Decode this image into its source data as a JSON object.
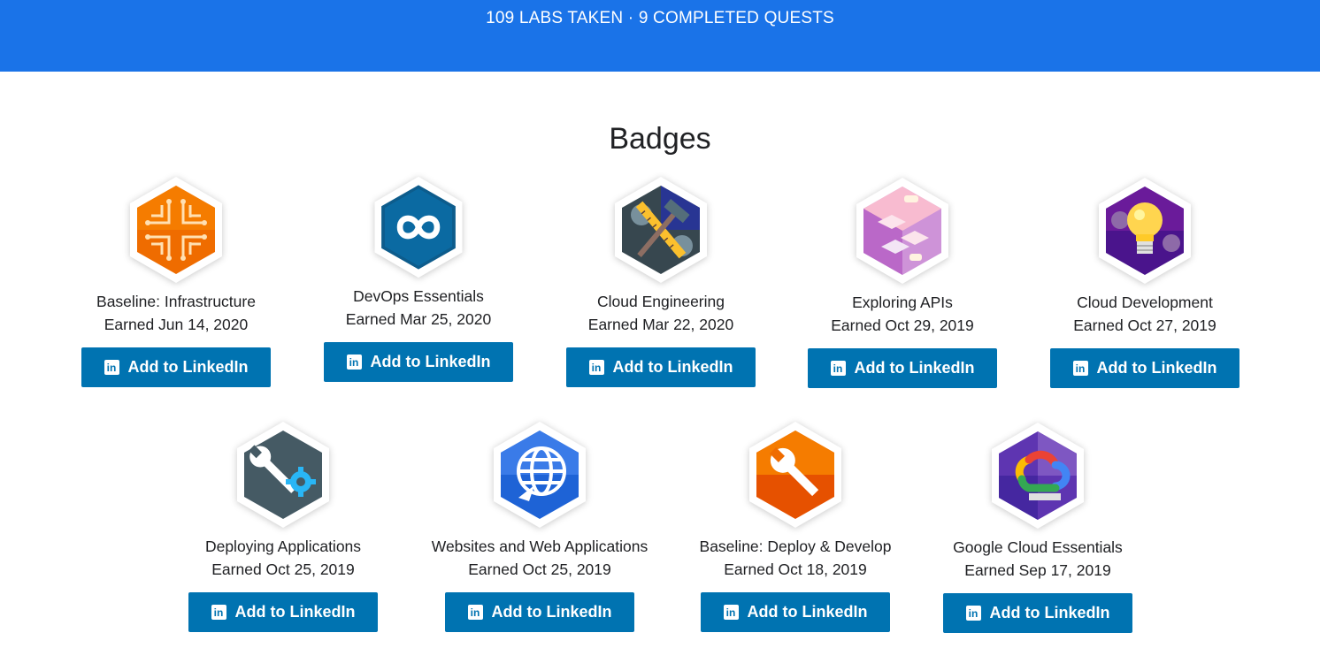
{
  "banner": {
    "stats": "109 LABS TAKEN · 9 COMPLETED QUESTS",
    "color": "#1a73e8"
  },
  "section": {
    "title": "Badges"
  },
  "linkedin": {
    "label": "Add to LinkedIn",
    "icon": "linkedin-icon",
    "color": "#0073b1"
  },
  "badges": [
    {
      "name": "Baseline: Infrastructure",
      "earned": "Earned Jun 14, 2020",
      "icon": "circuit-icon"
    },
    {
      "name": "DevOps Essentials",
      "earned": "Earned Mar 25, 2020",
      "icon": "infinity-icon"
    },
    {
      "name": "Cloud Engineering",
      "earned": "Earned Mar 22, 2020",
      "icon": "hammer-ruler-icon"
    },
    {
      "name": "Exploring APIs",
      "earned": "Earned Oct 29, 2019",
      "icon": "cubes-icon"
    },
    {
      "name": "Cloud Development",
      "earned": "Earned Oct 27, 2019",
      "icon": "lightbulb-icon"
    },
    {
      "name": "Deploying Applications",
      "earned": "Earned Oct 25, 2019",
      "icon": "wrench-gear-icon"
    },
    {
      "name": "Websites and Web Applications",
      "earned": "Earned Oct 25, 2019",
      "icon": "globe-icon"
    },
    {
      "name": "Baseline: Deploy & Develop",
      "earned": "Earned Oct 18, 2019",
      "icon": "wrench-icon"
    },
    {
      "name": "Google Cloud Essentials",
      "earned": "Earned Sep 17, 2019",
      "icon": "google-cloud-icon"
    }
  ]
}
